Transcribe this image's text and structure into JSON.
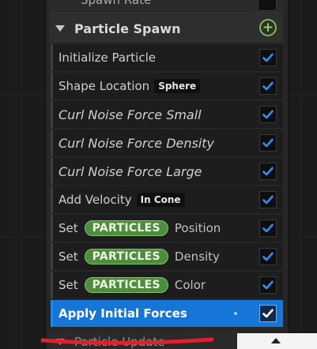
{
  "top_row": {
    "label": "Spawn Rate"
  },
  "section": {
    "title": "Particle Spawn",
    "add_label": "+"
  },
  "modules": [
    {
      "label": "Initialize Particle",
      "italic": false,
      "enabled": true
    },
    {
      "label": "Shape Location",
      "tag": "Sphere",
      "enabled": true
    },
    {
      "label": "Curl Noise Force Small",
      "italic": true,
      "enabled": true
    },
    {
      "label": "Curl Noise Force Density",
      "italic": true,
      "enabled": true
    },
    {
      "label": "Curl Noise Force Large",
      "italic": true,
      "enabled": true
    },
    {
      "label": "Add Velocity",
      "tag": "In Cone",
      "enabled": true
    },
    {
      "label": "Set",
      "pill": "PARTICLES",
      "suffix": "Position",
      "enabled": true
    },
    {
      "label": "Set",
      "pill": "PARTICLES",
      "suffix": "Density",
      "enabled": true
    },
    {
      "label": "Set",
      "pill": "PARTICLES",
      "suffix": "Color",
      "enabled": true
    },
    {
      "label": "Apply Initial Forces",
      "selected": true,
      "enabled": true
    }
  ],
  "bottom_section": {
    "title": "Particle Update"
  },
  "colors": {
    "selected": "#1676d8",
    "pill": "#4e8d3e",
    "add_icon": "#7fb74a",
    "annotation": "#e0202a"
  }
}
